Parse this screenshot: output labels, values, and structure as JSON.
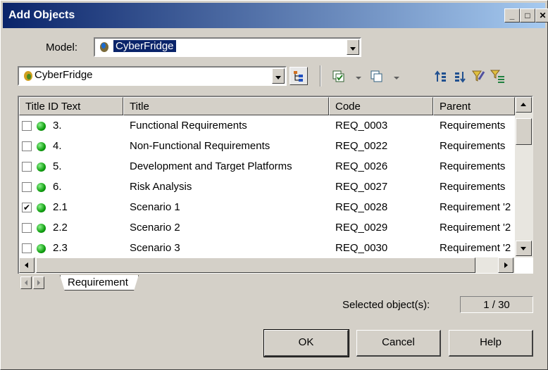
{
  "window": {
    "title": "Add Objects",
    "minimize": "_",
    "maximize": "□",
    "close": "✕"
  },
  "model": {
    "label": "Model:",
    "value": "CyberFridge"
  },
  "scope": {
    "value": "CyberFridge"
  },
  "columns": [
    "Title ID Text",
    "Title",
    "Code",
    "Parent"
  ],
  "rows": [
    {
      "checked": false,
      "id": "3.",
      "title": "Functional Requirements",
      "code": "REQ_0003",
      "parent": "Requirements"
    },
    {
      "checked": false,
      "id": "4.",
      "title": "Non-Functional Requirements",
      "code": "REQ_0022",
      "parent": "Requirements"
    },
    {
      "checked": false,
      "id": "5.",
      "title": "Development and Target Platforms",
      "code": "REQ_0026",
      "parent": "Requirements"
    },
    {
      "checked": false,
      "id": "6.",
      "title": "Risk Analysis",
      "code": "REQ_0027",
      "parent": "Requirements"
    },
    {
      "checked": true,
      "id": "2.1",
      "title": "Scenario 1",
      "code": "REQ_0028",
      "parent": "Requirement '2"
    },
    {
      "checked": false,
      "id": "2.2",
      "title": "Scenario 2",
      "code": "REQ_0029",
      "parent": "Requirement '2"
    },
    {
      "checked": false,
      "id": "2.3",
      "title": "Scenario 3",
      "code": "REQ_0030",
      "parent": "Requirement '2"
    }
  ],
  "tabs": {
    "active": "Requirement"
  },
  "status": {
    "label": "Selected object(s):",
    "count": "1 / 30"
  },
  "buttons": {
    "ok": "OK",
    "cancel": "Cancel",
    "help": "Help"
  },
  "colors": {
    "title_start": "#0a246a",
    "status_dot": "#10a010"
  }
}
